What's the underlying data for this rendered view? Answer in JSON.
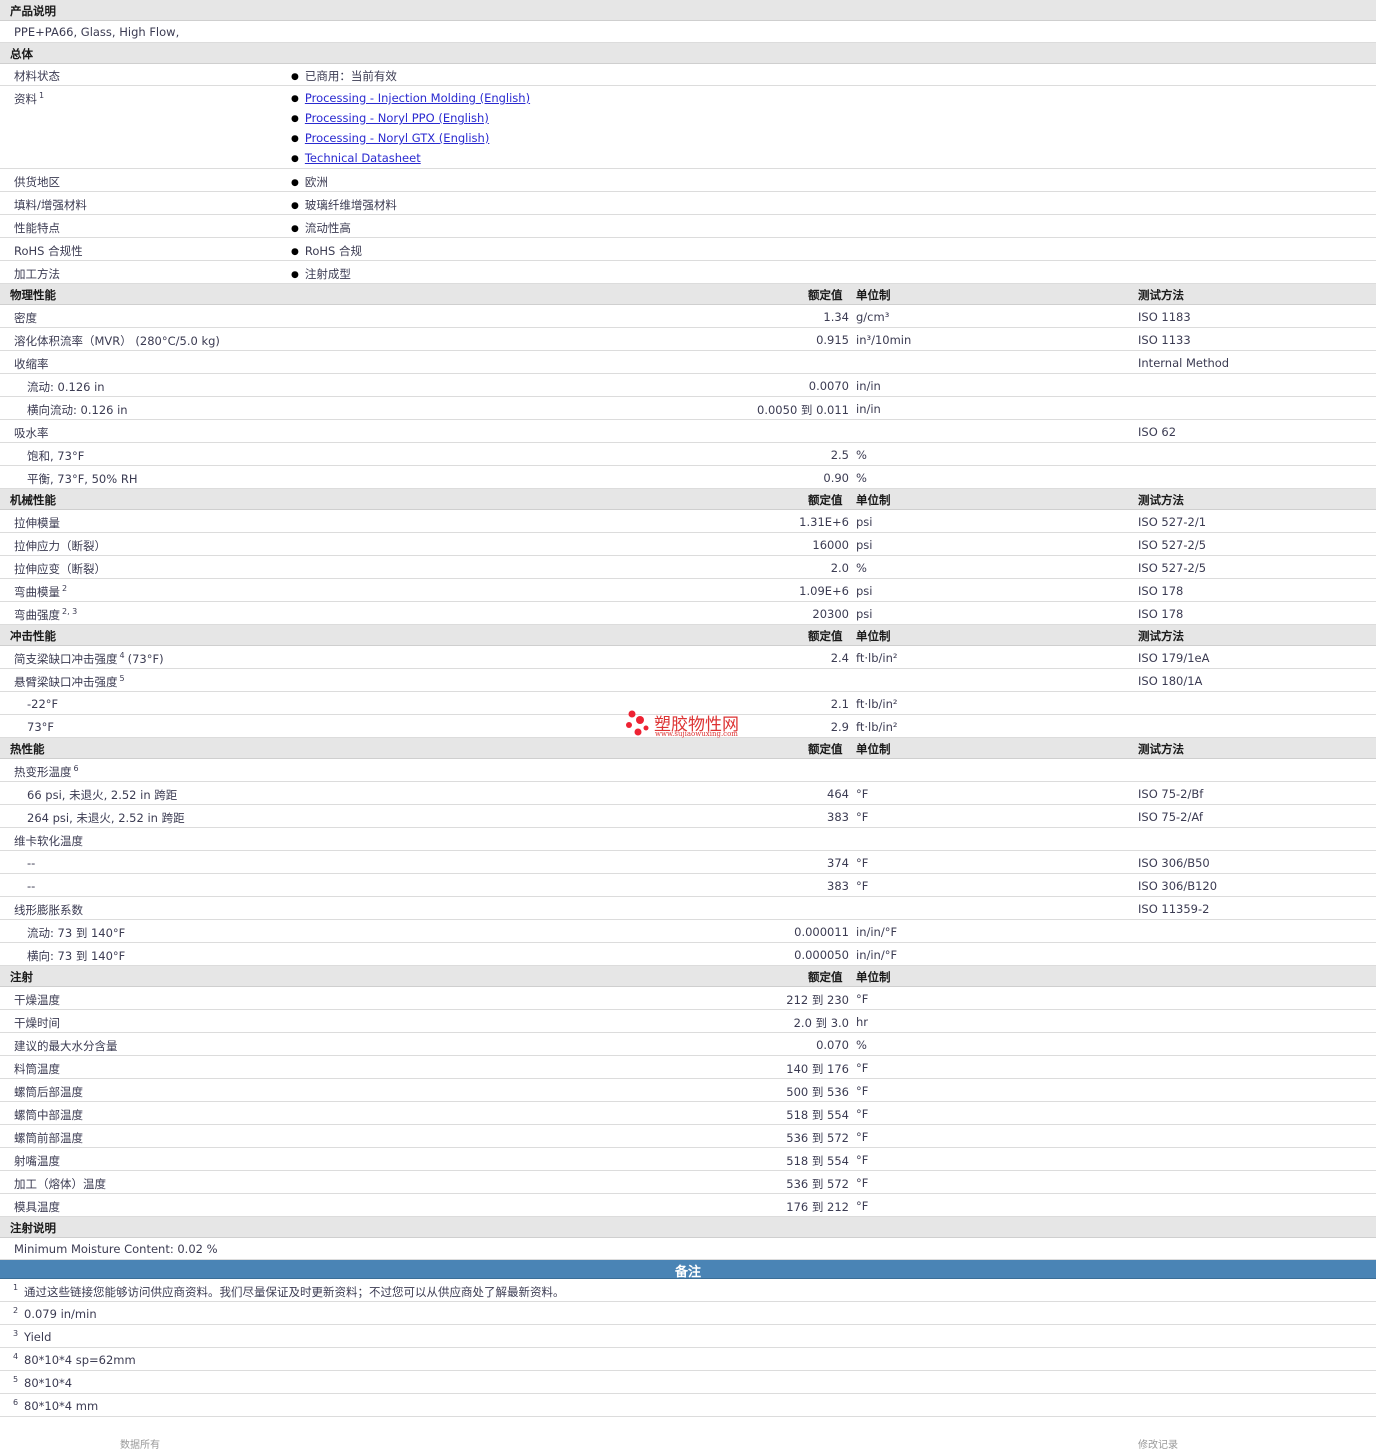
{
  "headers": {
    "value": "额定值",
    "unit": "单位制",
    "test": "测试方法"
  },
  "product": {
    "title": "产品说明",
    "desc": "PPE+PA66, Glass, High Flow,"
  },
  "general": {
    "title": "总体",
    "status_label": "材料状态",
    "status_value": "已商用：当前有效",
    "docs_label": "资料",
    "docs_sup": "1",
    "links": [
      "Processing - Injection Molding (English)",
      "Processing - Noryl PPO (English)",
      "Processing - Noryl GTX (English)",
      "Technical Datasheet"
    ],
    "region_label": "供货地区",
    "region_value": "欧洲",
    "filler_label": "填料/增强材料",
    "filler_value": "玻璃纤维增强材料",
    "feature_label": "性能特点",
    "feature_value": "流动性高",
    "rohs_label": "RoHS 合规性",
    "rohs_value": "RoHS 合规",
    "process_label": "加工方法",
    "process_value": "注射成型"
  },
  "physical": {
    "title": "物理性能",
    "rows": [
      {
        "label": "密度",
        "sup": "",
        "value": "1.34",
        "unit": "g/cm³",
        "test": "ISO 1183"
      },
      {
        "label": "溶化体积流率（MVR） (280°C/5.0 kg)",
        "sup": "",
        "value": "0.915",
        "unit": "in³/10min",
        "test": "ISO 1133"
      },
      {
        "label": "收缩率",
        "sup": "",
        "value": "",
        "unit": "",
        "test": "Internal Method"
      },
      {
        "label": "流动: 0.126 in",
        "sub": true,
        "value": "0.0070",
        "unit": "in/in",
        "test": ""
      },
      {
        "label": "横向流动: 0.126 in",
        "sub": true,
        "value": "0.0050 到  0.011",
        "unit": "in/in",
        "test": ""
      },
      {
        "label": "吸水率",
        "sup": "",
        "value": "",
        "unit": "",
        "test": "ISO 62"
      },
      {
        "label": "饱和, 73°F",
        "sub": true,
        "value": "2.5",
        "unit": "%",
        "test": ""
      },
      {
        "label": "平衡, 73°F, 50% RH",
        "sub": true,
        "value": "0.90",
        "unit": "%",
        "test": ""
      }
    ]
  },
  "mechanical": {
    "title": "机械性能",
    "rows": [
      {
        "label": "拉伸模量",
        "sup": "",
        "value": "1.31E+6",
        "unit": "psi",
        "test": "ISO 527-2/1"
      },
      {
        "label": "拉伸应力（断裂）",
        "sup": "",
        "value": "16000",
        "unit": "psi",
        "test": "ISO 527-2/5"
      },
      {
        "label": "拉伸应变（断裂）",
        "sup": "",
        "value": "2.0",
        "unit": "%",
        "test": "ISO 527-2/5"
      },
      {
        "label": "弯曲模量",
        "sup": "2",
        "value": "1.09E+6",
        "unit": "psi",
        "test": "ISO 178"
      },
      {
        "label": "弯曲强度",
        "sup": "2, 3",
        "value": "20300",
        "unit": "psi",
        "test": "ISO 178"
      }
    ]
  },
  "impact": {
    "title": "冲击性能",
    "rows": [
      {
        "label": "简支梁缺口冲击强度",
        "sup": "4",
        "tail": "(73°F)",
        "value": "2.4",
        "unit": "ft·lb/in²",
        "test": "ISO 179/1eA"
      },
      {
        "label": "悬臂梁缺口冲击强度",
        "sup": "5",
        "value": "",
        "unit": "",
        "test": "ISO 180/1A"
      },
      {
        "label": "-22°F",
        "sub": true,
        "value": "2.1",
        "unit": "ft·lb/in²",
        "test": ""
      },
      {
        "label": "73°F",
        "sub": true,
        "value": "2.9",
        "unit": "ft·lb/in²",
        "test": ""
      }
    ]
  },
  "thermal": {
    "title": "热性能",
    "rows": [
      {
        "label": "热变形温度",
        "sup": "6",
        "value": "",
        "unit": "",
        "test": ""
      },
      {
        "label": "66 psi, 未退火, 2.52 in 跨距",
        "sub": true,
        "value": "464",
        "unit": "°F",
        "test": "ISO 75-2/Bf"
      },
      {
        "label": "264 psi, 未退火, 2.52 in 跨距",
        "sub": true,
        "value": "383",
        "unit": "°F",
        "test": "ISO 75-2/Af"
      },
      {
        "label": "维卡软化温度",
        "sup": "",
        "value": "",
        "unit": "",
        "test": ""
      },
      {
        "label": "--",
        "sub": true,
        "value": "374",
        "unit": "°F",
        "test": "ISO 306/B50"
      },
      {
        "label": "--",
        "sub": true,
        "value": "383",
        "unit": "°F",
        "test": "ISO 306/B120"
      },
      {
        "label": "线形膨胀系数",
        "sup": "",
        "value": "",
        "unit": "",
        "test": "ISO 11359-2"
      },
      {
        "label": "流动: 73 到  140°F",
        "sub": true,
        "value": "0.000011",
        "unit": "in/in/°F",
        "test": ""
      },
      {
        "label": "横向: 73 到  140°F",
        "sub": true,
        "value": "0.000050",
        "unit": "in/in/°F",
        "test": ""
      }
    ]
  },
  "injection": {
    "title": "注射",
    "rows": [
      {
        "label": "干燥温度",
        "value": "212 到  230",
        "unit": "°F"
      },
      {
        "label": "干燥时间",
        "value": "2.0 到  3.0",
        "unit": "hr"
      },
      {
        "label": "建议的最大水分含量",
        "value": "0.070",
        "unit": "%"
      },
      {
        "label": "料筒温度",
        "value": "140 到  176",
        "unit": "°F"
      },
      {
        "label": "螺筒后部温度",
        "value": "500 到  536",
        "unit": "°F"
      },
      {
        "label": "螺筒中部温度",
        "value": "518 到  554",
        "unit": "°F"
      },
      {
        "label": "螺筒前部温度",
        "value": "536 到  572",
        "unit": "°F"
      },
      {
        "label": "射嘴温度",
        "value": "518 到  554",
        "unit": "°F"
      },
      {
        "label": "加工（熔体）温度",
        "value": "536 到  572",
        "unit": "°F"
      },
      {
        "label": "模具温度",
        "value": "176 到  212",
        "unit": "°F"
      }
    ]
  },
  "injection_notes": {
    "title": "注射说明",
    "text": "Minimum Moisture Content: 0.02 %"
  },
  "remarks": {
    "title": "备注",
    "items": [
      {
        "num": "1",
        "text": "通过这些链接您能够访问供应商资料。我们尽量保证及时更新资料；不过您可以从供应商处了解最新资料。"
      },
      {
        "num": "2",
        "text": "0.079 in/min"
      },
      {
        "num": "3",
        "text": "Yield"
      },
      {
        "num": "4",
        "text": "80*10*4 sp=62mm"
      },
      {
        "num": "5",
        "text": "80*10*4"
      },
      {
        "num": "6",
        "text": "80*10*4 mm"
      }
    ]
  },
  "watermark": {
    "name": "塑胶物性网",
    "url": "www.sujiaowuxing.com"
  },
  "footer": {
    "left": "数据所有",
    "right": "修改记录"
  }
}
